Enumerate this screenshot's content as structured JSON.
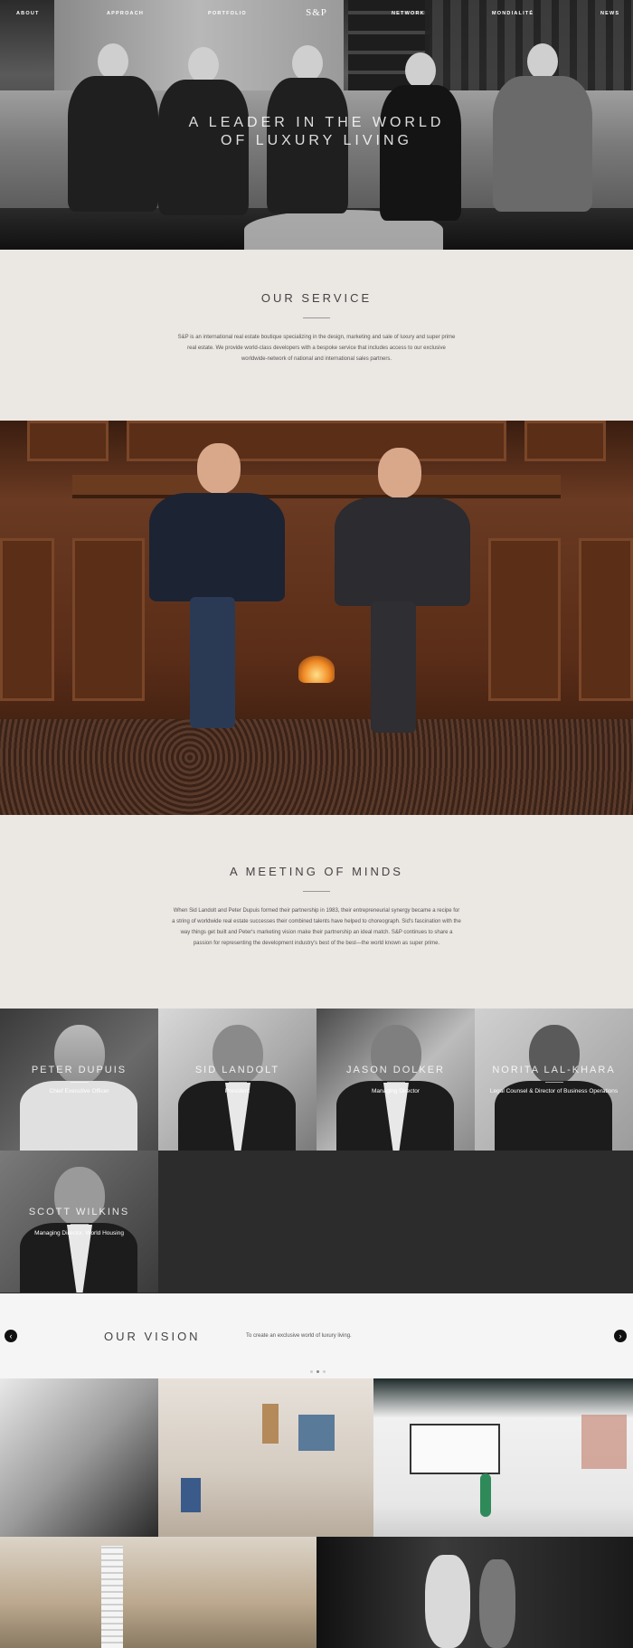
{
  "nav": {
    "links": [
      "ABOUT",
      "APPROACH",
      "PORTFOLIO",
      "NETWORK",
      "MONDIALITÉ",
      "NEWS"
    ],
    "logo": "S&P"
  },
  "hero": {
    "title_line1": "A LEADER IN THE WORLD",
    "title_line2": "OF LUXURY LIVING"
  },
  "service": {
    "title": "OUR SERVICE",
    "body": "S&P is an international real estate boutique specializing in the design, marketing and sale of luxury and super prime real estate. We provide world-class developers with a bespoke service that includes access to our exclusive worldwide-network of national and international sales partners."
  },
  "minds": {
    "title": "A MEETING OF MINDS",
    "body": "When Sid Landolt and Peter Dupuis formed their partnership in 1983, their entrepreneurial synergy became a recipe for a string of worldwide real estate successes their combined talents have helped to choreograph. Sid's fascination with the way things get built and Peter's marketing vision make their partnership an ideal match. S&P continues to share a passion for representing the development industry's best of the best—the world known as super prime."
  },
  "team": [
    {
      "name": "PETER DUPUIS",
      "role": "Chief Executive Officer"
    },
    {
      "name": "SID LANDOLT",
      "role": "President"
    },
    {
      "name": "JASON DOLKER",
      "role": "Managing Director"
    },
    {
      "name": "NORITA LAL-KHARA",
      "role": "Legal Counsel & Director of Business Operations"
    },
    {
      "name": "SCOTT WILKINS",
      "role": "Managing Director, World Housing"
    }
  ],
  "vision": {
    "title": "OUR VISION",
    "text": "To create an exclusive world of luxury living.",
    "prev_icon": "chevron-left-icon",
    "next_icon": "chevron-right-icon",
    "slide_count": 3,
    "active_slide": 2
  },
  "colors": {
    "background": "#ebe7e3",
    "team_bg": "#2c2c2c",
    "vision_bg": "#f5f5f5"
  }
}
